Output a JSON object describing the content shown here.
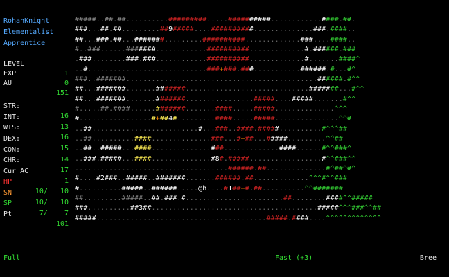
{
  "character": {
    "name": "RohanKnight",
    "race_class": "Elementalist",
    "title": "Apprentice"
  },
  "stats": {
    "level": {
      "label": "LEVEL",
      "value": "1"
    },
    "exp": {
      "label": "EXP",
      "value": "0"
    },
    "au": {
      "label": "AU",
      "value": "151"
    },
    "str": {
      "label": "STR:",
      "value": "16"
    },
    "int": {
      "label": "INT:",
      "value": "13"
    },
    "wis": {
      "label": "WIS:",
      "value": "16"
    },
    "dex": {
      "label": "DEX:",
      "value": "15"
    },
    "con": {
      "label": "CON:",
      "value": "14"
    },
    "chr": {
      "label": "CHR:",
      "value": "17"
    },
    "cur_ac": {
      "label": "Cur AC",
      "value": "1"
    },
    "hp": {
      "label": "HP",
      "value": "10/   10"
    },
    "sn": {
      "label": "SN",
      "value": "10/   10"
    },
    "sp": {
      "label": "SP",
      "value": "7/    7"
    },
    "pt": {
      "label": "Pt",
      "value": "101"
    }
  },
  "colors": {
    "title": "#55aaff",
    "label": "#e6e6e6",
    "value": "#33dd33",
    "hp_label": "#ff3333",
    "sn_label": "#ff9933",
    "sp_label": "#33dd33",
    "wall_gray": "#8a8a8a",
    "wall_red": "#cc2222",
    "wall_green": "#33cc33",
    "wall_white": "#ffffff",
    "wall_yellow": "#ffee55",
    "lava_orange": "#ff8800",
    "floor": "#666666"
  },
  "map": {
    "player_glyph": "@h",
    "rows": [
      "#####..##.##..........#########.....##########............####.##.",
      "###...##.##.........##9#####....##########..............###.####..",
      "##...###.##...#######.........##########.............###....####..",
      "#..###......#######............##########.............#.######.###",
      ".###........###.###............##########.............#.......####^",
      "..#............................###+###.###...........######.#...#^",
      "###..#######.............................................######.#^^",
      "##...#######.......#######.............................#######...#^^",
      "##...#######.......#######................#####....#####.......#^^",
      "#.....##.####......#######.......####.....#####..............^^^",
      "#.................#+##4#.........####.....#####...............^^#",
      "..##.........................#...###..####.#####..........#^^^##",
      "..##..........####..............###...#+##...#####.........^^##",
      "..##..#####...####..............###.............####......#^^###^",
      "..###.#####...####..............#8#.#####.................#^^###^^",
      "....................................######.##..............#^##^#^",
      "#....#2###..#####..#######.......######.##.............^^^#^^###",
      "#..........#####..######.....@h....#1##+#.##..........^^#######",
      "##.........#####..##.###.#.......................##........####^^#####",
      "###..........##3##.......................................#####^^^###^^##",
      "#####........................................#####.####....^^^^^^^^^^^^^"
    ]
  },
  "status_bar": {
    "left": "Full",
    "center": "Fast (+3)",
    "right": "Bree"
  }
}
